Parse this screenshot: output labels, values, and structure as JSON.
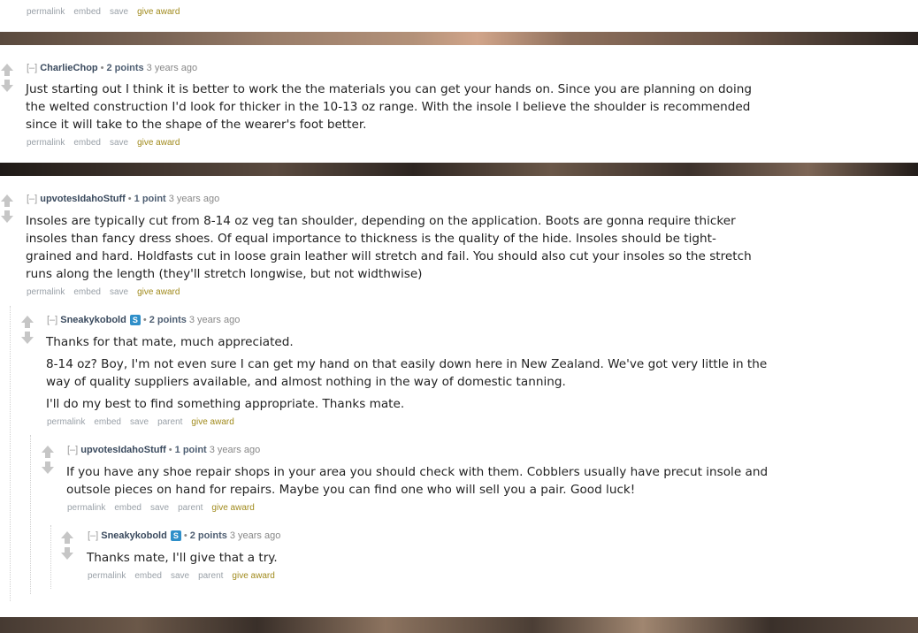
{
  "top_buttons": {
    "permalink": "permalink",
    "embed": "embed",
    "save": "save",
    "award": "give award"
  },
  "comments": [
    {
      "expand": "[–]",
      "author": "CharlieChop",
      "score": "2 points",
      "time": "3 years ago",
      "paragraphs": [
        "Just starting out I think it is better to work the the materials you can get your hands on. Since you are planning on doing the welted construction I'd look for thicker in the 10-13 oz range. With the insole I believe the shoulder is recommended since it will take to the shape of the wearer's foot better."
      ],
      "buttons": {
        "permalink": "permalink",
        "embed": "embed",
        "save": "save",
        "award": "give award"
      }
    },
    {
      "expand": "[–]",
      "author": "upvotesIdahoStuff",
      "score": "1 point",
      "time": "3 years ago",
      "paragraphs": [
        "Insoles are typically cut from 8-14 oz veg tan shoulder, depending on the application. Boots are gonna require thicker insoles than fancy dress shoes. Of equal importance to thickness is the quality of the hide. Insoles should be tight-grained and hard. Holdfasts cut in loose grain leather will stretch and fail. You should also cut your insoles so the stretch runs along the length (they'll stretch longwise, but not widthwise)"
      ],
      "buttons": {
        "permalink": "permalink",
        "embed": "embed",
        "save": "save",
        "award": "give award"
      }
    },
    {
      "expand": "[–]",
      "author": "Sneakykobold",
      "badge": "S",
      "score": "2 points",
      "time": "3 years ago",
      "paragraphs": [
        "Thanks for that mate, much appreciated.",
        "8-14 oz? Boy, I'm not even sure I can get my hand on that easily down here in New Zealand. We've got very little in the way of quality suppliers available, and almost nothing in the way of domestic tanning.",
        "I'll do my best to find something appropriate. Thanks mate."
      ],
      "buttons": {
        "permalink": "permalink",
        "embed": "embed",
        "save": "save",
        "parent": "parent",
        "award": "give award"
      }
    },
    {
      "expand": "[–]",
      "author": "upvotesIdahoStuff",
      "score": "1 point",
      "time": "3 years ago",
      "paragraphs": [
        "If you have any shoe repair shops in your area you should check with them. Cobblers usually have precut insole and outsole pieces on hand for repairs. Maybe you can find one who will sell you a pair. Good luck!"
      ],
      "buttons": {
        "permalink": "permalink",
        "embed": "embed",
        "save": "save",
        "parent": "parent",
        "award": "give award"
      }
    },
    {
      "expand": "[–]",
      "author": "Sneakykobold",
      "badge": "S",
      "score": "2 points",
      "time": "3 years ago",
      "paragraphs": [
        "Thanks mate, I'll give that a try."
      ],
      "buttons": {
        "permalink": "permalink",
        "embed": "embed",
        "save": "save",
        "parent": "parent",
        "award": "give award"
      }
    }
  ]
}
